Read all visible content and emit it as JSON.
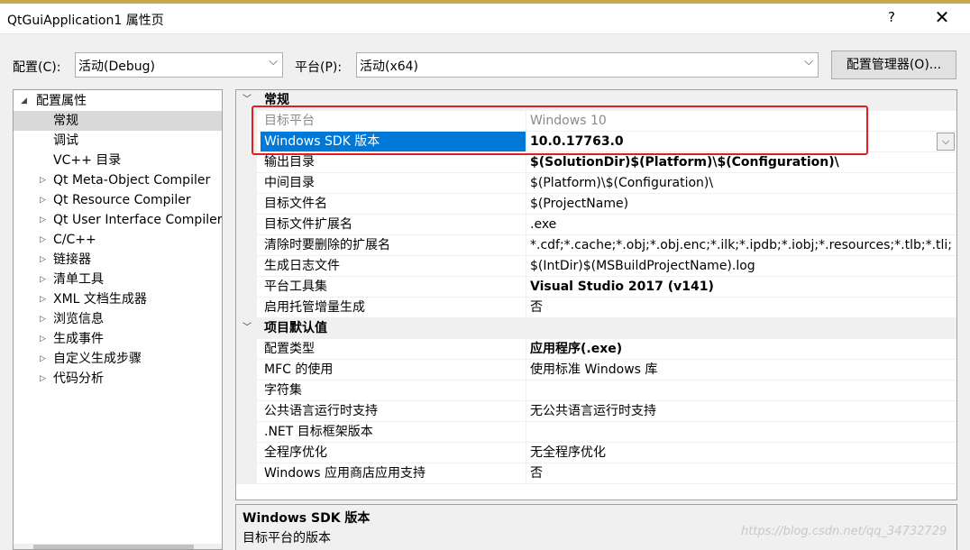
{
  "window": {
    "title": "QtGuiApplication1 属性页",
    "help": "?",
    "close": "✕"
  },
  "toolbar": {
    "config_label": "配置(C):",
    "config_value": "活动(Debug)",
    "platform_label": "平台(P):",
    "platform_value": "活动(x64)",
    "config_manager_button": "配置管理器(O)..."
  },
  "tree": {
    "root": "配置属性",
    "items": [
      {
        "label": "常规",
        "expandable": false,
        "selected": true
      },
      {
        "label": "调试",
        "expandable": false
      },
      {
        "label": "VC++ 目录",
        "expandable": false
      },
      {
        "label": "Qt Meta-Object Compiler",
        "expandable": true
      },
      {
        "label": "Qt Resource Compiler",
        "expandable": true
      },
      {
        "label": "Qt User Interface Compiler",
        "expandable": true
      },
      {
        "label": "C/C++",
        "expandable": true
      },
      {
        "label": "链接器",
        "expandable": true
      },
      {
        "label": "清单工具",
        "expandable": true
      },
      {
        "label": "XML 文档生成器",
        "expandable": true
      },
      {
        "label": "浏览信息",
        "expandable": true
      },
      {
        "label": "生成事件",
        "expandable": true
      },
      {
        "label": "自定义生成步骤",
        "expandable": true
      },
      {
        "label": "代码分析",
        "expandable": true
      }
    ]
  },
  "grid": {
    "section_general": "常规",
    "section_defaults": "项目默认值",
    "general_rows": [
      {
        "name": "目标平台",
        "value": "Windows 10"
      },
      {
        "name": "Windows SDK 版本",
        "value": "10.0.17763.0"
      },
      {
        "name": "输出目录",
        "value": "$(SolutionDir)$(Platform)\\$(Configuration)\\"
      },
      {
        "name": "中间目录",
        "value": "$(Platform)\\$(Configuration)\\"
      },
      {
        "name": "目标文件名",
        "value": "$(ProjectName)"
      },
      {
        "name": "目标文件扩展名",
        "value": ".exe"
      },
      {
        "name": "清除时要删除的扩展名",
        "value": "*.cdf;*.cache;*.obj;*.obj.enc;*.ilk;*.ipdb;*.iobj;*.resources;*.tlb;*.tli;"
      },
      {
        "name": "生成日志文件",
        "value": "$(IntDir)$(MSBuildProjectName).log"
      },
      {
        "name": "平台工具集",
        "value": "Visual Studio 2017 (v141)"
      },
      {
        "name": "启用托管增量生成",
        "value": "否"
      }
    ],
    "default_rows": [
      {
        "name": "配置类型",
        "value": "应用程序(.exe)"
      },
      {
        "name": "MFC 的使用",
        "value": "使用标准 Windows 库"
      },
      {
        "name": "字符集",
        "value": ""
      },
      {
        "name": "公共语言运行时支持",
        "value": "无公共语言运行时支持"
      },
      {
        "name": ".NET 目标框架版本",
        "value": ""
      },
      {
        "name": "全程序优化",
        "value": "无全程序优化"
      },
      {
        "name": "Windows 应用商店应用支持",
        "value": "否"
      }
    ]
  },
  "description": {
    "title": "Windows SDK 版本",
    "text": "目标平台的版本"
  },
  "watermark": "https://blog.csdn.net/qq_34732729",
  "colors": {
    "selection": "#0078d7",
    "highlight_box": "#e02020",
    "tree_selection": "#d9d9d9"
  }
}
